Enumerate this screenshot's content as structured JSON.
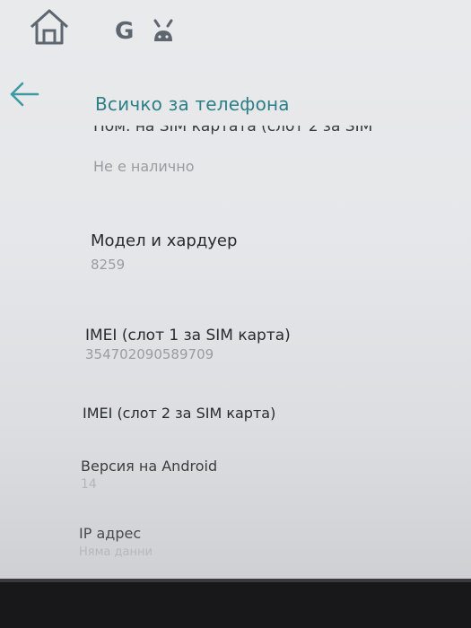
{
  "status_bar": {
    "icons": [
      "home-icon",
      "google-icon",
      "notification-icon"
    ],
    "google_letter": "G"
  },
  "app_bar": {
    "back_icon": "arrow-back-icon",
    "title": "Всичко за телефона"
  },
  "items": [
    {
      "id": "sim2-number",
      "title": "Ном. на SIM картата (слот 2 за SIM",
      "value": "Не е налично"
    },
    {
      "id": "model",
      "title": "Модел и хардуер",
      "value": "8259"
    },
    {
      "id": "imei1",
      "title": "IMEI (слот 1 за SIM карта)",
      "value": "354702090589709"
    },
    {
      "id": "imei2",
      "title": "IMEI (слот 2 за SIM карта)",
      "value": ""
    },
    {
      "id": "android-version",
      "title": "Версия на Android",
      "value": "14"
    },
    {
      "id": "ip-address",
      "title": "IP адрес",
      "value": "Няма данни"
    }
  ],
  "colors": {
    "accent": "#2d7f86",
    "title_text": "#2a2a2c",
    "secondary_text": "#9a9ca0",
    "background": "#e8e9eb"
  }
}
